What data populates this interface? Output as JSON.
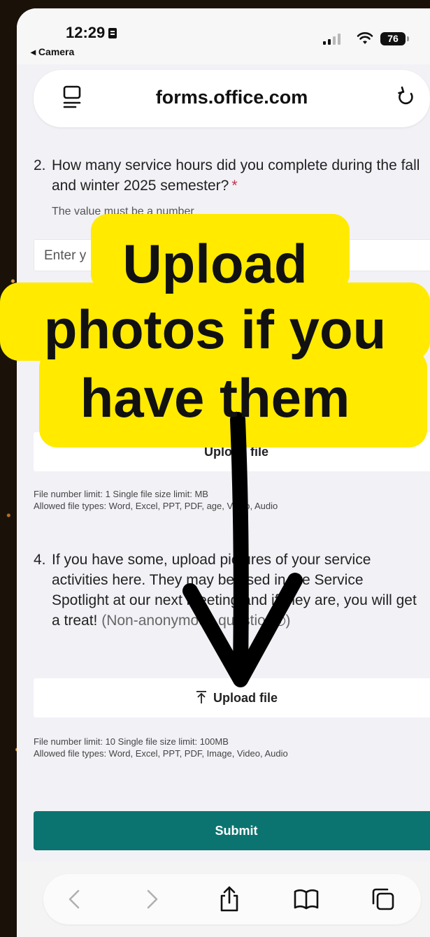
{
  "status_bar": {
    "time": "12:29",
    "back_app": "◂ Camera",
    "battery": "76"
  },
  "url_bar": {
    "url": "forms.office.com"
  },
  "form": {
    "q2": {
      "number": "2.",
      "text": "How many service hours did you complete during the fall and winter 2025 semester?",
      "required_mark": "*",
      "hint": "The value must be a number",
      "input_placeholder": "Enter y"
    },
    "q3_upload": {
      "upload_label": "Upload file",
      "limits_line1": "File number limit: 1   Single file size limit:      MB",
      "limits_line2": "Allowed file types: Word, Excel, PPT, PDF,     age, Video, Audio"
    },
    "q4": {
      "number": "4.",
      "text": "If you have some, upload pictures of your service activities here. They may be used in the Service Spotlight at our next meeting and if they are, you will get a treat!",
      "note": "(Non-anonymous question",
      "note_end": ")",
      "upload_label": "Upload file",
      "limits_line1": "File number limit: 10   Single file size limit: 100MB",
      "limits_line2": "Allowed file types: Word, Excel, PPT, PDF, Image, Video, Audio"
    },
    "submit_label": "Submit"
  },
  "overlay": {
    "line1": "Upload",
    "line2": "photos if you",
    "line3": "have them",
    "highlight_color": "#ffea00",
    "arrow_color": "#000000"
  },
  "colors": {
    "submit": "#0b7470",
    "required": "#c4314b"
  }
}
